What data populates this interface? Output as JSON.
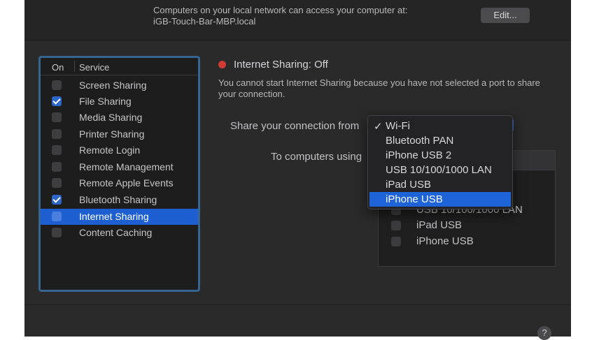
{
  "header": {
    "host_line1": "Computers on your local network can access your computer at:",
    "host_line2": "iGB-Touch-Bar-MBP.local",
    "edit_label": "Edit..."
  },
  "services": {
    "col_on": "On",
    "col_service": "Service",
    "items": [
      {
        "label": "Screen Sharing",
        "checked": false
      },
      {
        "label": "File Sharing",
        "checked": true
      },
      {
        "label": "Media Sharing",
        "checked": false
      },
      {
        "label": "Printer Sharing",
        "checked": false
      },
      {
        "label": "Remote Login",
        "checked": false
      },
      {
        "label": "Remote Management",
        "checked": false
      },
      {
        "label": "Remote Apple Events",
        "checked": false
      },
      {
        "label": "Bluetooth Sharing",
        "checked": true
      },
      {
        "label": "Internet Sharing",
        "checked": false,
        "selected": true
      },
      {
        "label": "Content Caching",
        "checked": false
      }
    ]
  },
  "detail": {
    "status_title": "Internet Sharing: Off",
    "status_desc": "You cannot start Internet Sharing because you have not selected a port to share your connection.",
    "share_from_label": "Share your connection from",
    "to_computers_label": "To computers using"
  },
  "share_menu": {
    "checkmark": "✓",
    "items": [
      {
        "label": "Wi-Fi",
        "checked": true
      },
      {
        "label": "Bluetooth PAN"
      },
      {
        "label": "iPhone USB 2"
      },
      {
        "label": "USB 10/100/1000 LAN"
      },
      {
        "label": "iPad USB"
      },
      {
        "label": "iPhone USB",
        "highlighted": true
      }
    ]
  },
  "ports": {
    "items": [
      {
        "label": "USB 10/100/1000 LAN"
      },
      {
        "label": "iPad USB"
      },
      {
        "label": "iPhone USB"
      }
    ]
  },
  "help_label": "?",
  "colors": {
    "accent": "#1f63d8",
    "status_off": "#d13b33",
    "focus_ring": "#36658f"
  }
}
